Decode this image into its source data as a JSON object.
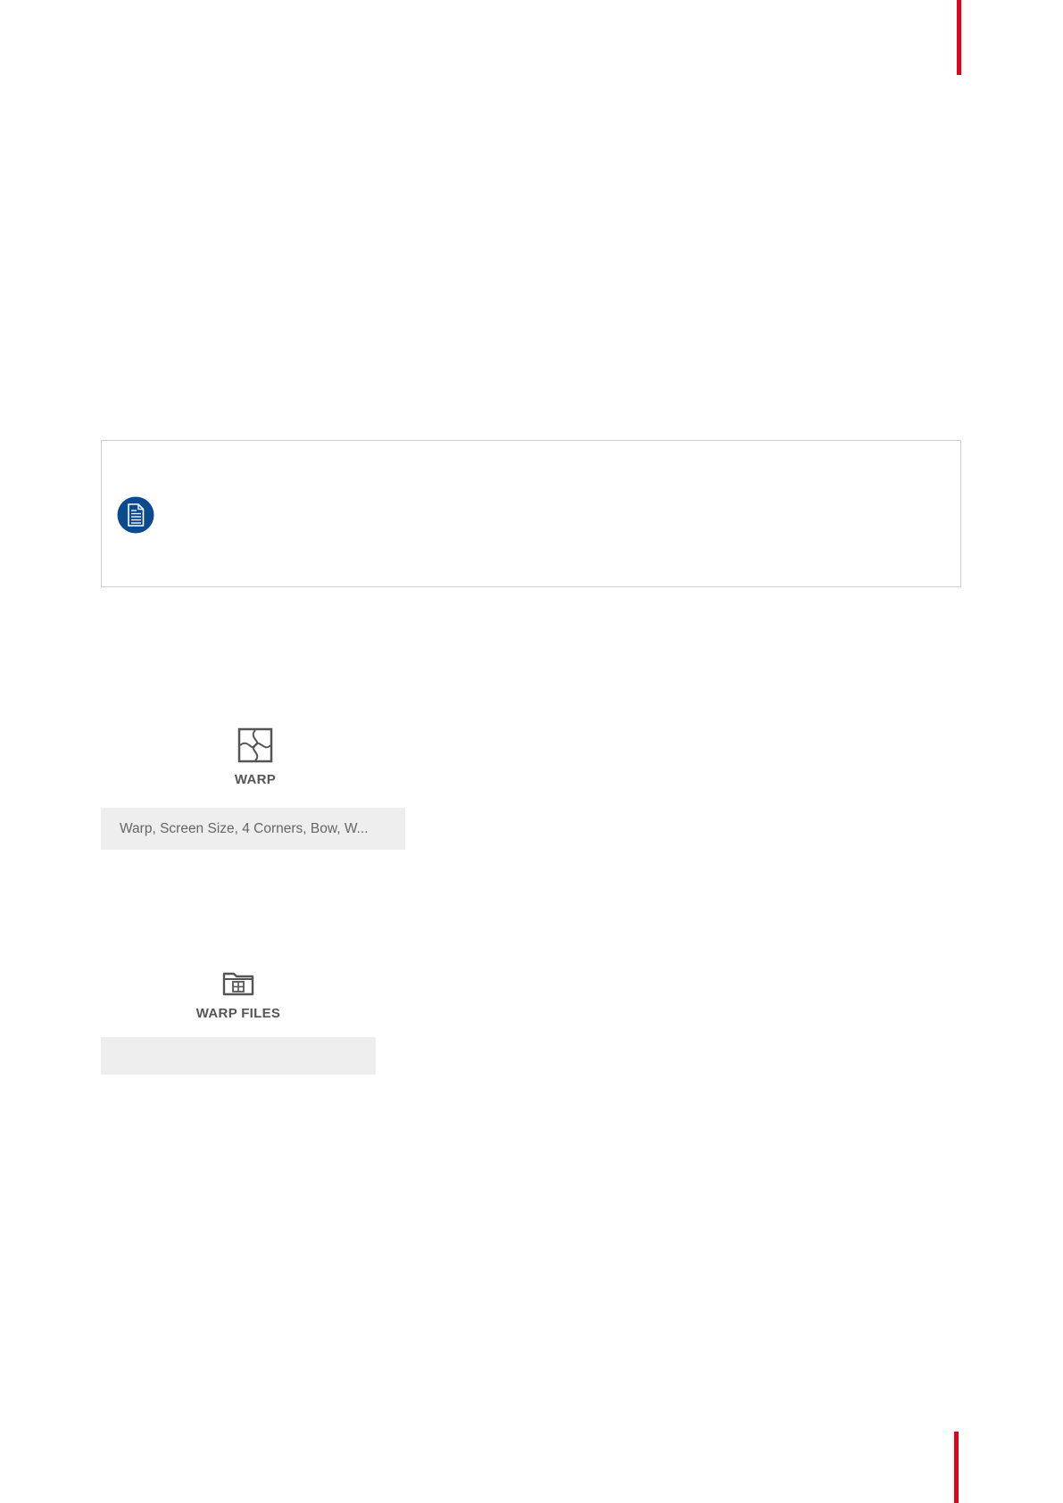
{
  "accent_color": "#e2001a",
  "note": {
    "icon": "document-note-icon",
    "icon_color": "#0b4a8f"
  },
  "warp_tile": {
    "icon": "warp-icon",
    "label": "WARP",
    "description": "Warp, Screen Size, 4 Corners, Bow, W..."
  },
  "warp_files_tile": {
    "icon": "folder-grid-icon",
    "label": "WARP FILES",
    "description": ""
  }
}
